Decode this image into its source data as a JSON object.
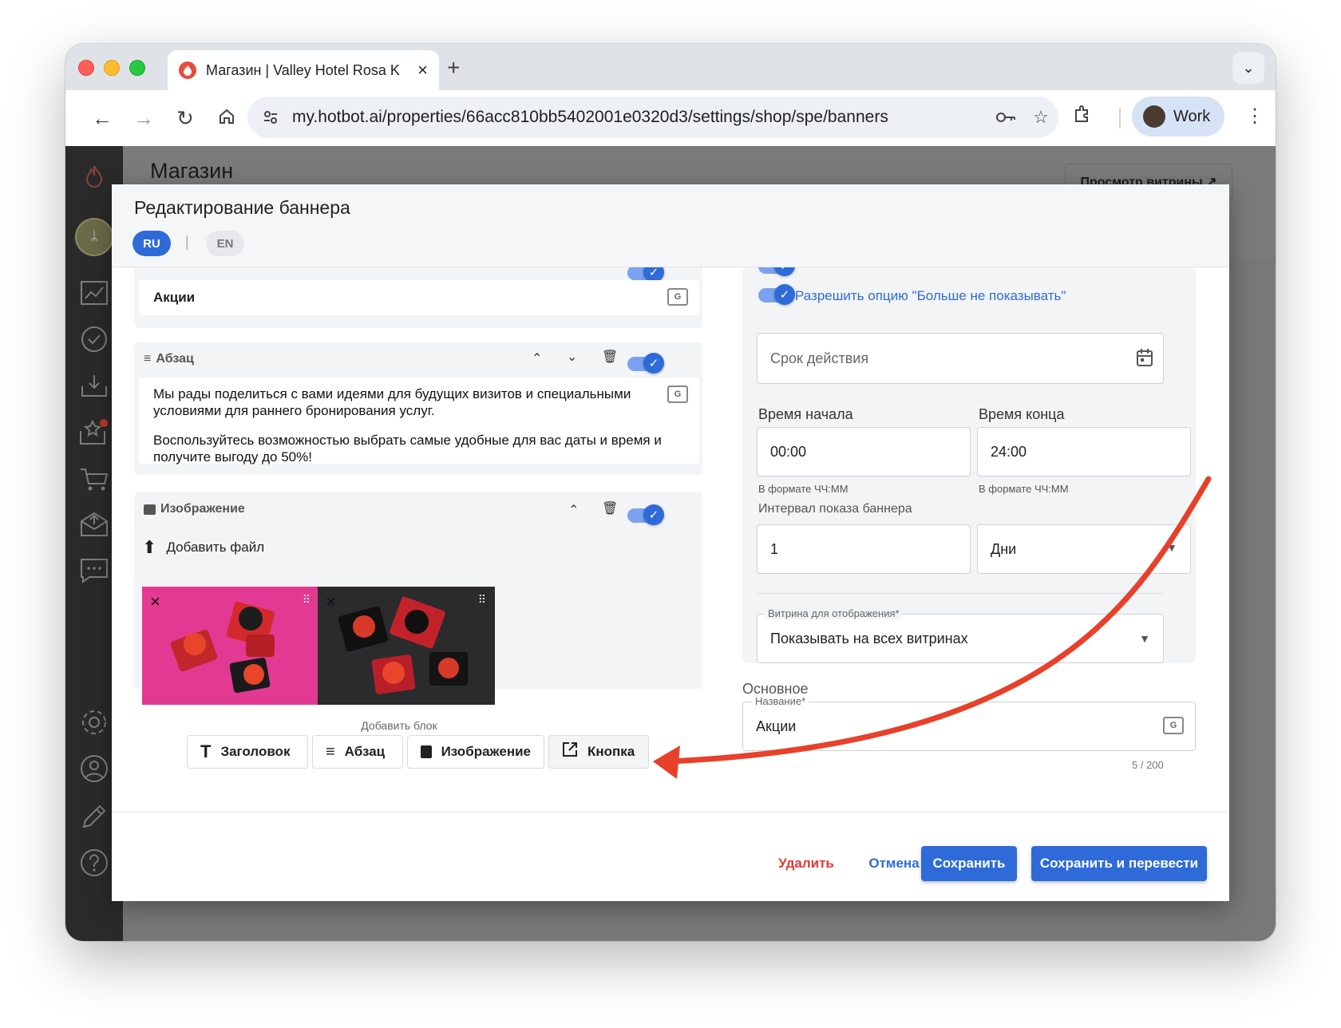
{
  "browser": {
    "tab_title": "Магазин | Valley Hotel Rosa K",
    "url": "my.hotbot.ai/properties/66acc810bb5402001e0320d3/settings/shop/spe/banners",
    "profile_name": "Work"
  },
  "app": {
    "page_title": "Магазин",
    "view_store_button": "Просмотр витрины ↗"
  },
  "modal": {
    "title": "Редактирование баннера",
    "lang_ru": "RU",
    "lang_divider": "|",
    "lang_en": "EN",
    "heading_block": {
      "value": "Акции"
    },
    "paragraph_block": {
      "label": "Абзац",
      "text_1": "Мы рады поделиться с вами идеями для будущих визитов и специальными условиями для раннего бронирования услуг.",
      "text_2": "Воспользуйтесь возможностью выбрать самые удобные для вас даты и время и получите выгоду до 50%!"
    },
    "image_block": {
      "label": "Изображение",
      "add_file": "Добавить файл"
    },
    "add_block": {
      "label": "Добавить блок",
      "heading": "Заголовок",
      "paragraph": "Абзац",
      "image": "Изображение",
      "button": "Кнопка"
    },
    "settings": {
      "allow_dont_show": "Разрешить опцию \"Больше не показывать\"",
      "validity_placeholder": "Срок действия",
      "start_time_label": "Время начала",
      "start_time": "00:00",
      "start_time_help": "В формате ЧЧ:ММ",
      "end_time_label": "Время конца",
      "end_time": "24:00",
      "end_time_help": "В формате ЧЧ:ММ",
      "interval_label": "Интервал показа баннера",
      "interval_value": "1",
      "interval_unit": "Дни",
      "storefront_label": "Витрина для отображения*",
      "storefront_value": "Показывать на всех витринах"
    },
    "general": {
      "section_label": "Основное",
      "name_label": "Название*",
      "name_value": "Акции",
      "counter": "5 / 200"
    },
    "footer": {
      "delete": "Удалить",
      "cancel": "Отмена",
      "save": "Сохранить",
      "save_translate": "Сохранить и перевести"
    }
  },
  "colors": {
    "primary": "#2f6bd8",
    "danger": "#e53935",
    "annotation_arrow": "#e8402a"
  }
}
